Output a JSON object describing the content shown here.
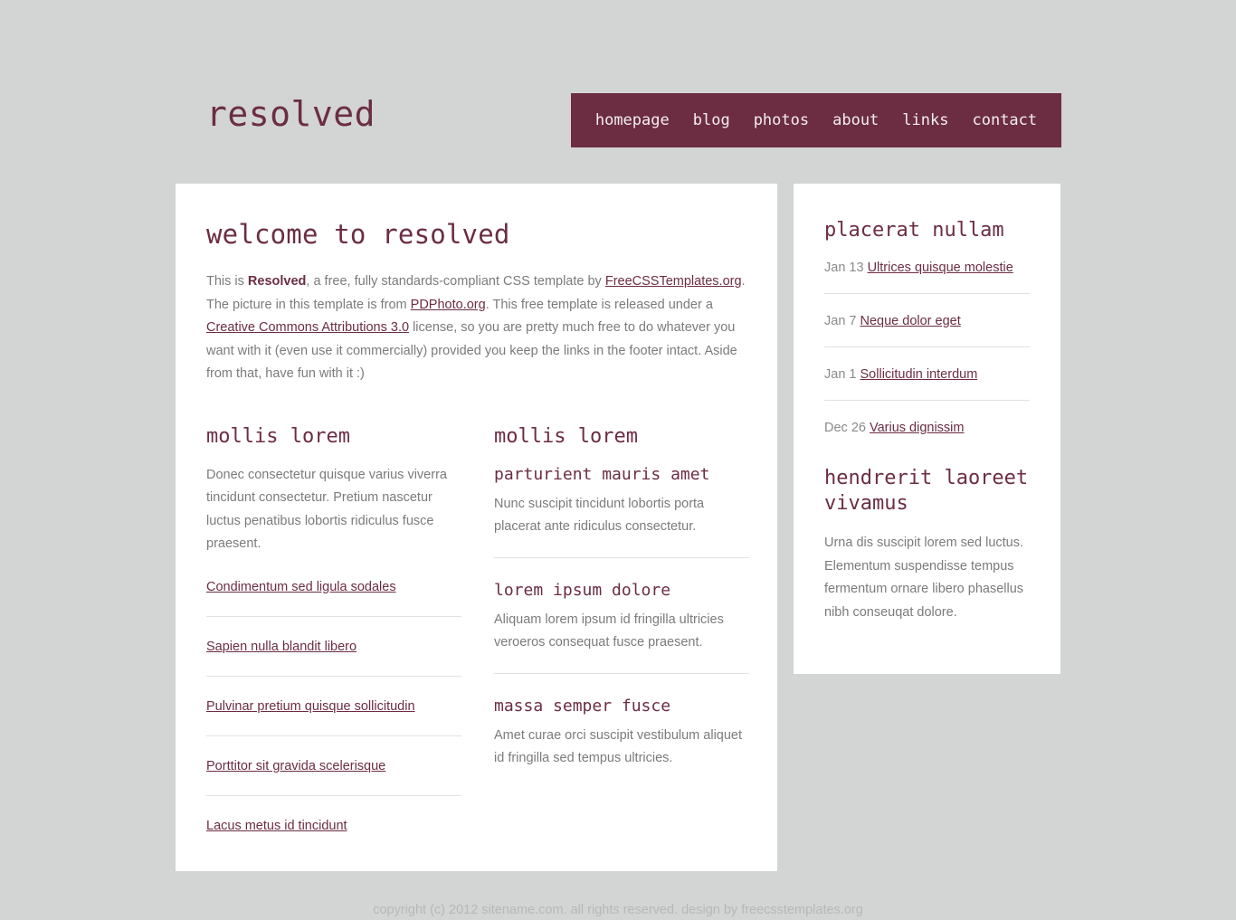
{
  "header": {
    "logo": "resolved",
    "nav": [
      {
        "label": "homepage"
      },
      {
        "label": "blog"
      },
      {
        "label": "photos"
      },
      {
        "label": "about"
      },
      {
        "label": "links"
      },
      {
        "label": "contact"
      }
    ]
  },
  "content": {
    "page_title": "welcome to resolved",
    "intro": {
      "part1": "This is ",
      "strong": "Resolved",
      "part2": ", a free, fully standards-compliant CSS template by ",
      "link1": "FreeCSSTemplates.org",
      "part3": ". The picture in this template is from ",
      "link2": "PDPhoto.org",
      "part4": ". This free template is released under a ",
      "link3": "Creative Commons Attributions 3.0",
      "part5": " license, so you are pretty much free to do whatever you want with it (even use it commercially) provided you keep the links in the footer intact. Aside from that, have fun with it :)"
    },
    "left_column": {
      "title": "mollis lorem",
      "paragraph": "Donec consectetur quisque varius viverra tincidunt consectetur. Pretium nascetur luctus penatibus lobortis ridiculus fusce praesent.",
      "links": [
        {
          "label": "Condimentum sed ligula sodales"
        },
        {
          "label": "Sapien nulla blandit libero"
        },
        {
          "label": "Pulvinar pretium quisque sollicitudin"
        },
        {
          "label": "Porttitor sit gravida scelerisque"
        },
        {
          "label": "Lacus metus id tincidunt"
        }
      ]
    },
    "right_column": {
      "title": "mollis lorem",
      "boxes": [
        {
          "title": "parturient mauris amet",
          "text": "Nunc suscipit tincidunt lobortis porta placerat ante ridiculus consectetur."
        },
        {
          "title": "lorem ipsum dolore",
          "text": "Aliquam lorem ipsum id fringilla ultricies veroeros consequat fusce praesent."
        },
        {
          "title": "massa semper fusce",
          "text": "Amet curae orci suscipit vestibulum aliquet id fringilla sed tempus ultricies."
        }
      ]
    }
  },
  "sidebar": {
    "news": {
      "title": "placerat nullam",
      "items": [
        {
          "date": "Jan 13",
          "label": "Ultrices quisque molestie"
        },
        {
          "date": "Jan 7",
          "label": "Neque dolor eget"
        },
        {
          "date": "Jan 1",
          "label": "Sollicitudin interdum"
        },
        {
          "date": "Dec 26",
          "label": "Varius dignissim"
        }
      ]
    },
    "about": {
      "title": "hendrerit laoreet vivamus",
      "text": "Urna dis suscipit lorem sed luctus. Elementum suspendisse tempus fermentum ornare libero phasellus nibh conseuqat dolore."
    }
  },
  "footer": {
    "text": "copyright (c) 2012 sitename.com. all rights reserved. design by freecsstemplates.org"
  },
  "colors": {
    "accent": "#6c2d42",
    "page_background": "#d2d5d4",
    "panel_background": "#ffffff",
    "body_text": "#7b7b7b",
    "divider": "#e2e2e2",
    "footer_text": "#b4b8b7"
  }
}
